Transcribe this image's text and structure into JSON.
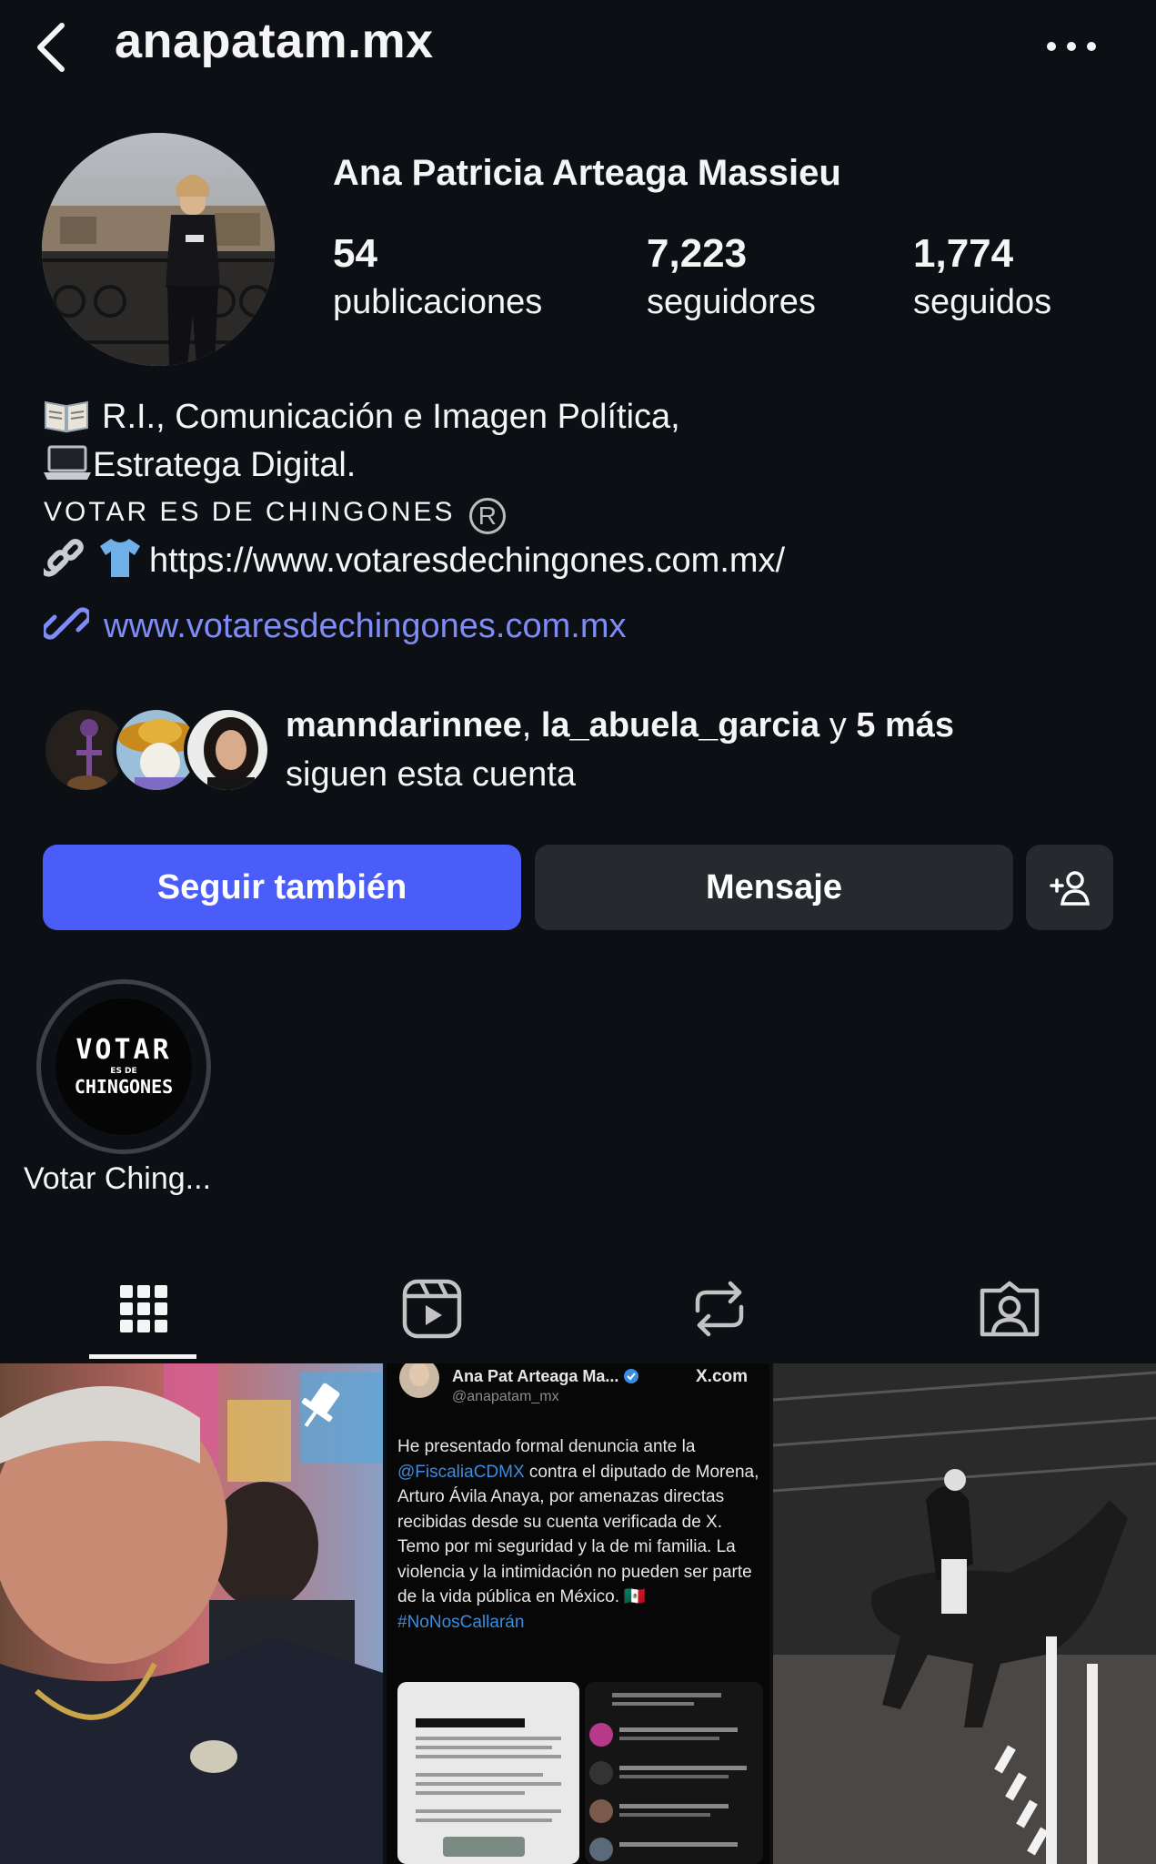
{
  "header": {
    "username": "anapatam.mx"
  },
  "profile": {
    "full_name": "Ana Patricia Arteaga Massieu",
    "stats": [
      {
        "value": "54",
        "label": "publicaciones"
      },
      {
        "value": "7,223",
        "label": "seguidores"
      },
      {
        "value": "1,774",
        "label": "seguidos"
      }
    ],
    "bio": {
      "line1": "R.I., Comunicación e Imagen Política,",
      "line2": "Estratega Digital.",
      "line3": "VOTAR ES DE CHINGONES",
      "line3_symbol": "R",
      "line4": "https://www.votaresdechingones.com.mx/"
    },
    "link": "www.votaresdechingones.com.mx",
    "followed_by": {
      "user1": "manndarinnee",
      "sep": ", ",
      "user2": "la_abuela_garcia",
      "and": " y ",
      "more": "5 más",
      "suffix": "siguen esta cuenta"
    }
  },
  "actions": {
    "follow": "Seguir también",
    "message": "Mensaje"
  },
  "highlights": [
    {
      "label": "Votar Ching...",
      "cover_top": "VOTAR",
      "cover_mid": "ES DE",
      "cover_bottom": "CHINGONES"
    }
  ],
  "tabs": [
    "posts-grid",
    "reels",
    "reposts",
    "tagged"
  ],
  "grid": {
    "tweet": {
      "name": "Ana Pat Arteaga Ma...",
      "handle": "@anapatam_mx",
      "source": "X.com",
      "text_a": "He presentado formal denuncia ante la ",
      "mention": "@FiscaliaCDMX",
      "text_b": " contra el diputado de Morena, Arturo Ávila Anaya, por amenazas directas recibidas desde su cuenta verificada de X. Temo por mi seguridad y la de mi familia. La violencia y la intimidación no pueden ser parte de la vida pública en México. 🇲🇽",
      "hashtag": "#NoNosCallarán"
    }
  },
  "colors": {
    "background": "#0c1014",
    "accent": "#4a5df9",
    "link": "#7f8cf5",
    "button": "#262a2f"
  }
}
